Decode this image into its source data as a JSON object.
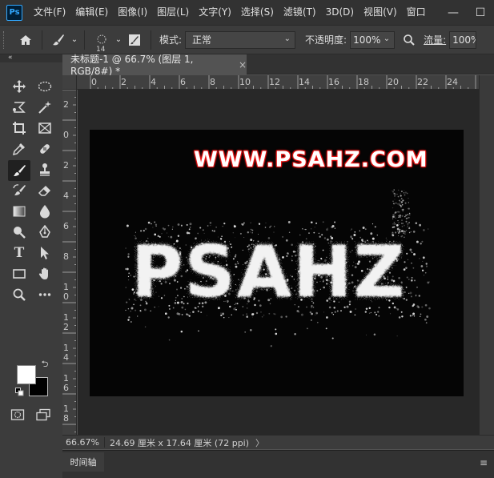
{
  "app": {
    "logo": "Ps"
  },
  "menu": [
    "文件(F)",
    "编辑(E)",
    "图像(I)",
    "图层(L)",
    "文字(Y)",
    "选择(S)",
    "滤镜(T)",
    "3D(D)",
    "视图(V)",
    "窗口"
  ],
  "window_controls": {
    "minimize": "—",
    "restore": "☐"
  },
  "options": {
    "brush_size": "14",
    "mode_label": "模式:",
    "mode_value": "正常",
    "opacity_label": "不透明度:",
    "opacity_value": "100%",
    "flow_label": "流量:",
    "flow_value": "100%"
  },
  "tools_panel": {
    "collapse": "«"
  },
  "document": {
    "tab_title": "未标题-1 @ 66.7% (图层 1, RGB/8#) *",
    "close": "×"
  },
  "ruler": {
    "top": [
      "0",
      "2",
      "4",
      "6",
      "8",
      "10",
      "12",
      "14",
      "16",
      "18",
      "20",
      "22",
      "24"
    ],
    "left": [
      "2",
      "0",
      "2",
      "4",
      "6",
      "8",
      "1",
      "0",
      "1",
      "2",
      "1",
      "4",
      "1",
      "6",
      "1",
      "8"
    ]
  },
  "canvas": {
    "brand_text": "WWW.PSAHZ.COM",
    "main_text": "PSAHZ",
    "background": "#050505",
    "brand_glow": "#ff2020"
  },
  "status": {
    "zoom": "66.67%",
    "info": "24.69 厘米 x 17.64 厘米 (72 ppi)",
    "arrow": "〉"
  },
  "timeline": {
    "tab": "时间轴",
    "menu": "≡"
  }
}
